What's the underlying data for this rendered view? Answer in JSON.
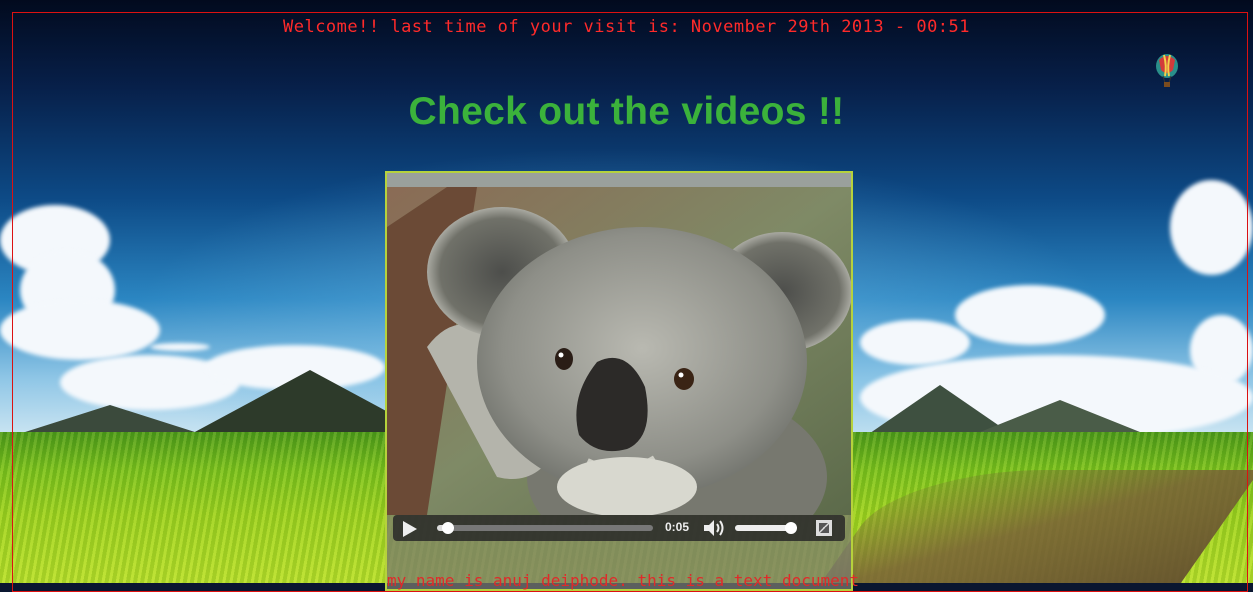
{
  "header": {
    "welcome_text": "Welcome!! last time of your visit is: November 29th 2013 - 00:51",
    "title": "Check out the videos !!"
  },
  "video_player": {
    "current_time": "0:05",
    "progress": 0.05,
    "volume": 0.9,
    "poster_subject": "koala"
  },
  "caption": {
    "text": "my name is anuj deiphode. this is a text document"
  },
  "icons": {
    "play": "play-icon",
    "volume": "volume-icon",
    "fullscreen": "fullscreen-icon",
    "balloon": "hot-air-balloon-icon"
  },
  "colors": {
    "welcome": "#ff2a2a",
    "title": "#3bb23b",
    "video_border": "#b6d23c",
    "page_border": "#d11111"
  }
}
